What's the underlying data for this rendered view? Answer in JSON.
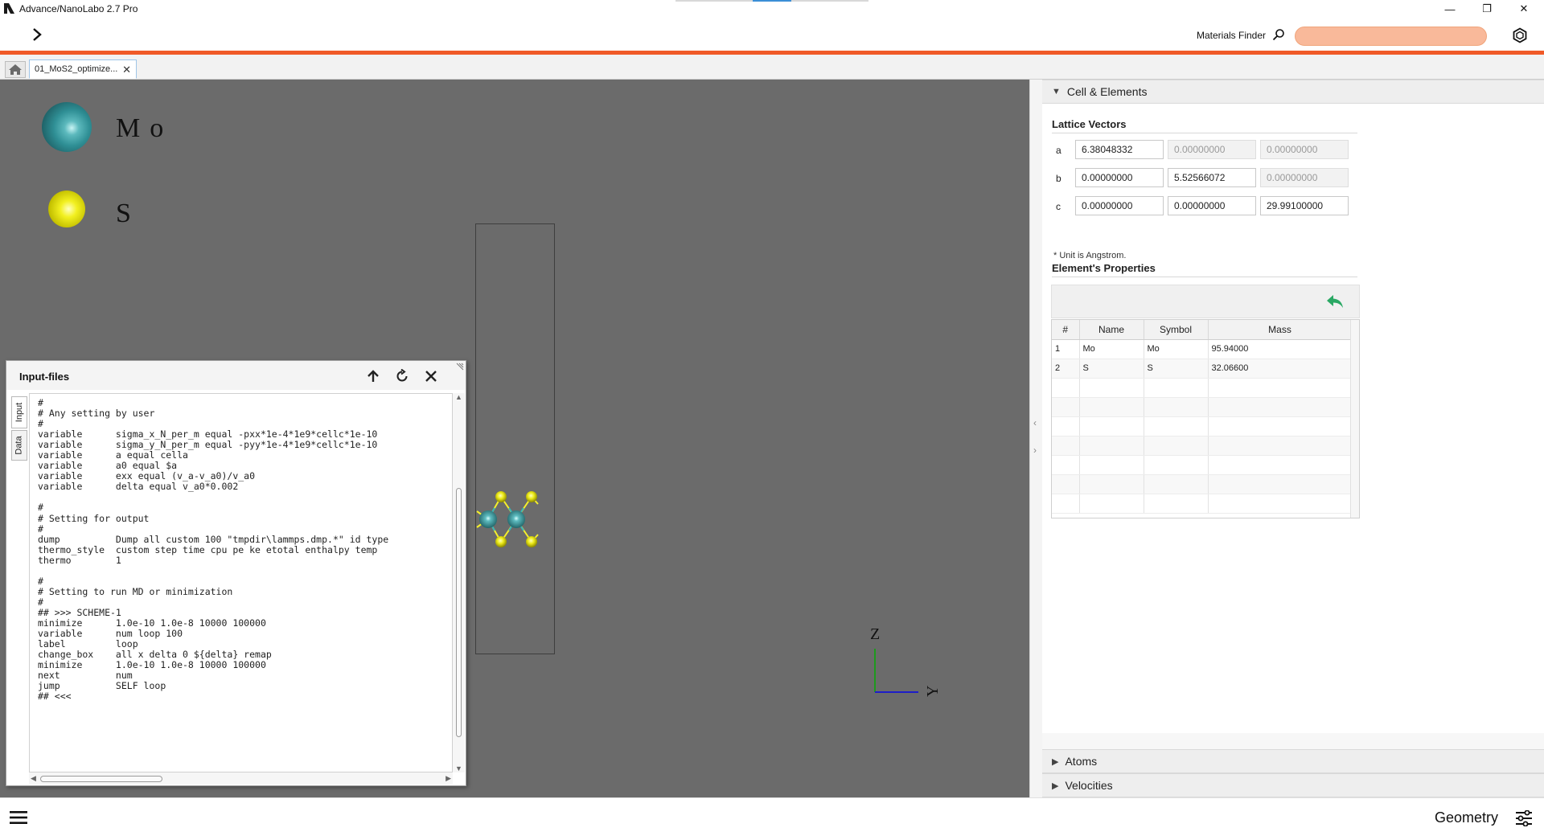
{
  "window": {
    "title": "Advance/NanoLabo 2.7 Pro",
    "minimize_label": "—",
    "restore_label": "❐",
    "close_label": "✕"
  },
  "toolbar": {
    "materials_finder_label": "Materials Finder",
    "search_value": "",
    "accent_color": "#f05a28"
  },
  "tabs": {
    "home_icon": "home-icon",
    "file_tab_label": "01_MoS2_optimize...",
    "file_tab_close": "✕"
  },
  "viewer": {
    "legend": [
      {
        "element": "Mo",
        "display": "Mo",
        "color": "#3a9ea3"
      },
      {
        "element": "S",
        "display": "S",
        "color": "#e8e61a"
      }
    ],
    "axis_z_label": "Z",
    "axis_y_label": "Y"
  },
  "input_panel": {
    "title": "Input-files",
    "side_tabs": [
      "Input",
      "Data"
    ],
    "code": [
      "#",
      "# Any setting by user",
      "#",
      "variable      sigma_x_N_per_m equal -pxx*1e-4*1e9*cellc*1e-10",
      "variable      sigma_y_N_per_m equal -pyy*1e-4*1e9*cellc*1e-10",
      "variable      a equal cella",
      "variable      a0 equal $a",
      "variable      exx equal (v_a-v_a0)/v_a0",
      "variable      delta equal v_a0*0.002",
      "",
      "#",
      "# Setting for output",
      "#",
      "dump          Dump all custom 100 \"tmpdir\\lammps.dmp.*\" id type",
      "thermo_style  custom step time cpu pe ke etotal enthalpy temp",
      "thermo        1",
      "",
      "#",
      "# Setting to run MD or minimization",
      "#",
      "## >>> SCHEME-1",
      "minimize      1.0e-10 1.0e-8 10000 100000",
      "variable      num loop 100",
      "label         loop",
      "change_box    all x delta 0 ${delta} remap",
      "minimize      1.0e-10 1.0e-8 10000 100000",
      "next          num",
      "jump          SELF loop",
      "## <<<"
    ]
  },
  "cell_elements": {
    "header": "Cell & Elements",
    "lattice_heading": "Lattice Vectors",
    "lattice": [
      {
        "label": "a",
        "values": [
          "6.38048332",
          "0.00000000",
          "0.00000000"
        ],
        "enabled": [
          true,
          false,
          false
        ]
      },
      {
        "label": "b",
        "values": [
          "0.00000000",
          "5.52566072",
          "0.00000000"
        ],
        "enabled": [
          true,
          true,
          false
        ]
      },
      {
        "label": "c",
        "values": [
          "0.00000000",
          "0.00000000",
          "29.99100000"
        ],
        "enabled": [
          true,
          true,
          true
        ]
      }
    ],
    "unit_note": "* Unit is Angstrom.",
    "props_heading": "Element's Properties",
    "columns": [
      "#",
      "Name",
      "Symbol",
      "Mass"
    ],
    "rows": [
      [
        "1",
        "Mo",
        "Mo",
        "95.94000"
      ],
      [
        "2",
        "S",
        "S",
        "32.06600"
      ]
    ],
    "empty_rows": 7
  },
  "collapsed_sections": [
    {
      "label": "Atoms"
    },
    {
      "label": "Velocities"
    }
  ],
  "bottom": {
    "mode_label": "Geometry"
  }
}
